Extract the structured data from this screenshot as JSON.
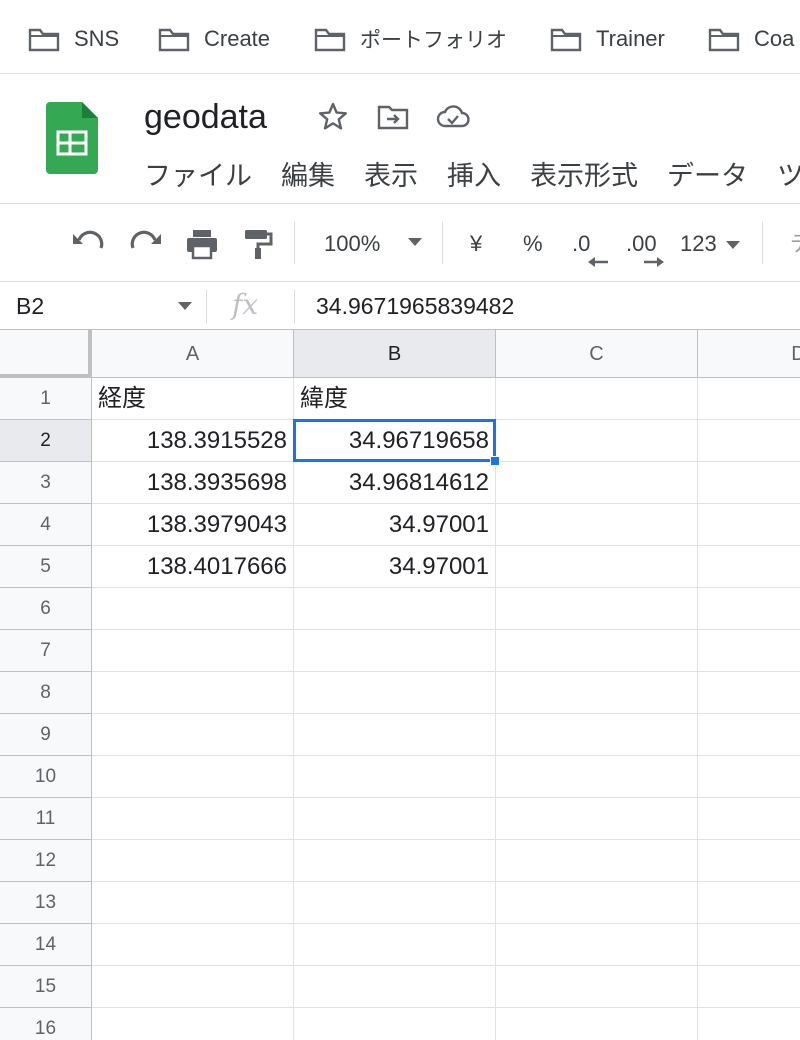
{
  "bookmarks": [
    {
      "label": "SNS",
      "icon": "folder-icon"
    },
    {
      "label": "Create",
      "icon": "folder-icon"
    },
    {
      "label": "ポートフォリオ",
      "icon": "folder-icon"
    },
    {
      "label": "Trainer",
      "icon": "folder-icon"
    },
    {
      "label": "Coa",
      "icon": "folder-icon"
    }
  ],
  "document": {
    "title": "geodata",
    "icons": [
      "star-icon",
      "move-to-folder-icon",
      "cloud-saved-icon"
    ]
  },
  "menu": [
    "ファイル",
    "編集",
    "表示",
    "挿入",
    "表示形式",
    "データ",
    "ツ"
  ],
  "toolbar": {
    "zoom": "100%",
    "currency": "¥",
    "percent": "%",
    "decrease_decimal": ".0",
    "increase_decimal": ".00",
    "number_format": "123",
    "truncated_label": "デ"
  },
  "formula_bar": {
    "name_box": "B2",
    "fx": "fx",
    "value": "34.9671965839482"
  },
  "grid": {
    "columns": [
      "A",
      "B",
      "C",
      "D"
    ],
    "rows": [
      "1",
      "2",
      "3",
      "4",
      "5",
      "6",
      "7",
      "8",
      "9",
      "10",
      "11",
      "12",
      "13",
      "14",
      "15",
      "16"
    ],
    "cells": [
      [
        "経度",
        "緯度",
        "",
        ""
      ],
      [
        "138.3915528",
        "34.96719658",
        "",
        ""
      ],
      [
        "138.3935698",
        "34.96814612",
        "",
        ""
      ],
      [
        "138.3979043",
        "34.97001",
        "",
        ""
      ],
      [
        "138.4017666",
        "34.97001",
        "",
        ""
      ]
    ],
    "selected_cell": "B2",
    "selected_column": "B",
    "selected_row": "2"
  },
  "colors": {
    "accent": "#1a73e8",
    "sheets_green": "#34a853",
    "sheets_green_dark": "#188038"
  }
}
